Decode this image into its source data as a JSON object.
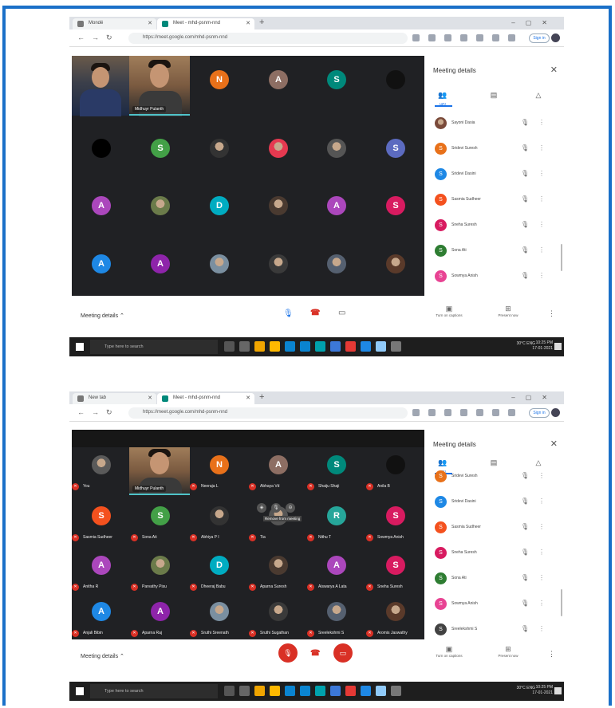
{
  "browser": {
    "tab1_title": "Mondé",
    "tab2_title": "Meet - mhd-psnm-nnd",
    "tab2b_title": "Meet - mhd-psnm-nnd",
    "tab1b_title": "New tab",
    "url": "https://meet.google.com/mhd-psnm-nnd",
    "signin_label": "Sign in"
  },
  "shot1": {
    "self_label": "Midhuyr Pulanth",
    "tiles": [
      {
        "initial": "N",
        "color": "#e8711a",
        "kind": "letter"
      },
      {
        "initial": "A",
        "color": "#8d6e63",
        "kind": "letter"
      },
      {
        "initial": "S",
        "color": "#00897b",
        "kind": "letter"
      },
      {
        "initial": "",
        "color": "#111111",
        "kind": "dark"
      },
      {
        "initial": "",
        "color": "#000000",
        "kind": "dark"
      },
      {
        "initial": "S",
        "color": "#43a047",
        "kind": "letter"
      },
      {
        "initial": "",
        "color": "#333333",
        "kind": "photo"
      },
      {
        "initial": "",
        "color": "#e53950",
        "kind": "photo"
      },
      {
        "initial": "",
        "color": "#555555",
        "kind": "photo"
      },
      {
        "initial": "S",
        "color": "#5c6bc0",
        "kind": "letter"
      },
      {
        "initial": "A",
        "color": "#ab47bc",
        "kind": "letter"
      },
      {
        "initial": "",
        "color": "#6b7b4a",
        "kind": "photo"
      },
      {
        "initial": "D",
        "color": "#00acc1",
        "kind": "letter"
      },
      {
        "initial": "",
        "color": "#4a3a30",
        "kind": "photo"
      },
      {
        "initial": "A",
        "color": "#ab47bc",
        "kind": "letter"
      },
      {
        "initial": "S",
        "color": "#d81b60",
        "kind": "letter"
      },
      {
        "initial": "A",
        "color": "#1e88e5",
        "kind": "letter"
      },
      {
        "initial": "A",
        "color": "#8e24aa",
        "kind": "letter"
      },
      {
        "initial": "",
        "color": "#7a8fa0",
        "kind": "photo"
      },
      {
        "initial": "",
        "color": "#3a3a3a",
        "kind": "photo"
      },
      {
        "initial": "",
        "color": "#556070",
        "kind": "photo"
      },
      {
        "initial": "",
        "color": "#5a3a2a",
        "kind": "photo"
      }
    ],
    "panel": {
      "title": "Meeting details",
      "people_count": "(45)",
      "participants": [
        {
          "name": "Sayoni Dasia",
          "initial": "",
          "color": "#7a4a3a"
        },
        {
          "name": "Sridevi Suresh",
          "initial": "S",
          "color": "#e8711a"
        },
        {
          "name": "Sridevi Dasini",
          "initial": "S",
          "color": "#1e88e5"
        },
        {
          "name": "Sasmia Sudheer",
          "initial": "S",
          "color": "#f4511e"
        },
        {
          "name": "Sneha Suresh",
          "initial": "S",
          "color": "#d81b60"
        },
        {
          "name": "Sona Ati",
          "initial": "S",
          "color": "#2e7d32"
        },
        {
          "name": "Sowmya Anish",
          "initial": "S",
          "color": "#e84393"
        }
      ]
    },
    "bottom": {
      "meeting_details": "Meeting details",
      "captions": "Turn on captions",
      "present": "Present now"
    }
  },
  "shot2": {
    "self_label": "Midhuyr Pulanth",
    "tooltip": "Remove from meeting",
    "tiles": [
      {
        "initial": "",
        "color": "#5a5a5a",
        "kind": "photo",
        "name": "You"
      },
      {
        "initial": "N",
        "color": "#e8711a",
        "kind": "letter",
        "name": "Neeraja L"
      },
      {
        "initial": "A",
        "color": "#8d6e63",
        "kind": "letter",
        "name": "Abhaya Vd"
      },
      {
        "initial": "S",
        "color": "#00897b",
        "kind": "letter",
        "name": "Shaiju Shaji"
      },
      {
        "initial": "",
        "color": "#111111",
        "kind": "dark",
        "name": "Anila B"
      },
      {
        "initial": "S",
        "color": "#f4511e",
        "kind": "letter",
        "name": "Sasmia Sudheer"
      },
      {
        "initial": "S",
        "color": "#43a047",
        "kind": "letter",
        "name": "Sona Ati"
      },
      {
        "initial": "",
        "color": "#333333",
        "kind": "photo",
        "name": "Abhiya P I"
      },
      {
        "initial": "",
        "color": "#555555",
        "kind": "photo",
        "name": "Tia"
      },
      {
        "initial": "R",
        "color": "#26a69a",
        "kind": "letter",
        "name": "Nithu T"
      },
      {
        "initial": "S",
        "color": "#d81b60",
        "kind": "letter",
        "name": "Sowmya Anish"
      },
      {
        "initial": "A",
        "color": "#ab47bc",
        "kind": "letter",
        "name": "Anitha R"
      },
      {
        "initial": "",
        "color": "#6b7b4a",
        "kind": "photo",
        "name": "Parvathy Pisu"
      },
      {
        "initial": "D",
        "color": "#00acc1",
        "kind": "letter",
        "name": "Dheeraj Babu"
      },
      {
        "initial": "",
        "color": "#4a3a30",
        "kind": "photo",
        "name": "Aparna Suresh"
      },
      {
        "initial": "A",
        "color": "#ab47bc",
        "kind": "letter",
        "name": "Aiswarya A Lata"
      },
      {
        "initial": "S",
        "color": "#d81b60",
        "kind": "letter",
        "name": "Sneha Suresh"
      },
      {
        "initial": "A",
        "color": "#1e88e5",
        "kind": "letter",
        "name": "Anjali Bibin"
      },
      {
        "initial": "A",
        "color": "#8e24aa",
        "kind": "letter",
        "name": "Aparna Raj"
      },
      {
        "initial": "",
        "color": "#7a8fa0",
        "kind": "photo",
        "name": "Sruthi Sreenath"
      },
      {
        "initial": "",
        "color": "#3a3a3a",
        "kind": "photo",
        "name": "Sruthi Sugathan"
      },
      {
        "initial": "",
        "color": "#556070",
        "kind": "photo",
        "name": "Sreelekshmi S"
      },
      {
        "initial": "",
        "color": "#5a3a2a",
        "kind": "photo",
        "name": "Aromis Jaswathy"
      }
    ],
    "panel": {
      "title": "Meeting details",
      "people_count": "(45)",
      "participants": [
        {
          "name": "Sridevi Suresh",
          "initial": "S",
          "color": "#e8711a"
        },
        {
          "name": "Sridevi Dasini",
          "initial": "S",
          "color": "#1e88e5"
        },
        {
          "name": "Sasmia Sudheer",
          "initial": "S",
          "color": "#f4511e"
        },
        {
          "name": "Sneha Suresh",
          "initial": "S",
          "color": "#d81b60"
        },
        {
          "name": "Sona Ati",
          "initial": "S",
          "color": "#2e7d32"
        },
        {
          "name": "Sowmya Anish",
          "initial": "S",
          "color": "#e84393"
        },
        {
          "name": "Sreelekshmi S",
          "initial": "S",
          "color": "#424242"
        }
      ]
    },
    "bottom": {
      "meeting_details": "Meeting details",
      "captions": "Turn on captions",
      "present": "Present now"
    }
  },
  "taskbar": {
    "search_placeholder": "Type here to search",
    "tray_text": "30°C ENG",
    "time": "10:25 PM",
    "date": "17-01-2021"
  },
  "colors": {
    "frame_border": "#1a70c8",
    "meet_bg": "#202124",
    "end_call": "#d93025",
    "active_speaker": "#4fc3c9"
  }
}
